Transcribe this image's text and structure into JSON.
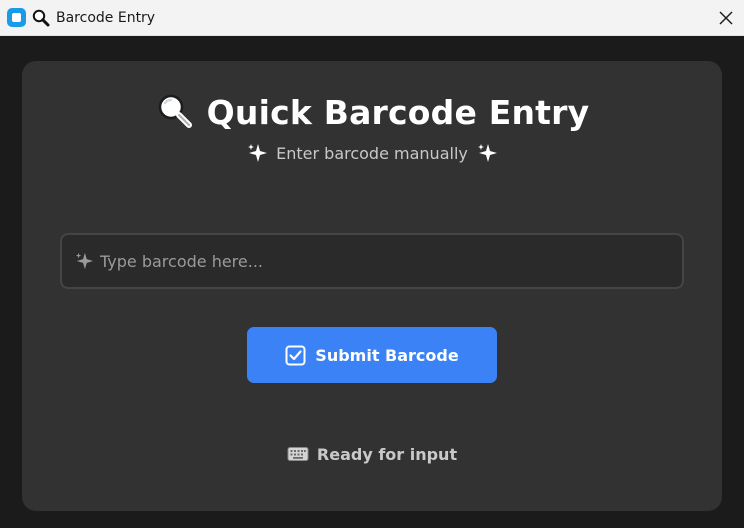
{
  "window": {
    "title": "Barcode Entry",
    "close_icon": "close-icon",
    "app_icon": "app-icon",
    "title_icon": "magnifier-icon"
  },
  "main": {
    "heading": "Quick Barcode Entry",
    "heading_icon": "magnifier-icon",
    "subtitle": "Enter barcode manually",
    "subtitle_icon": "sparkles-icon"
  },
  "input": {
    "placeholder": "Type barcode here...",
    "value": "",
    "icon": "sparkles-icon"
  },
  "submit": {
    "label": "Submit Barcode",
    "icon": "checkbox-icon"
  },
  "status": {
    "text": "Ready for input",
    "icon": "keyboard-icon"
  },
  "colors": {
    "accent": "#3b82f6",
    "card": "#323232",
    "background": "#1b1b1b",
    "titlebar": "#f3f3f3"
  }
}
